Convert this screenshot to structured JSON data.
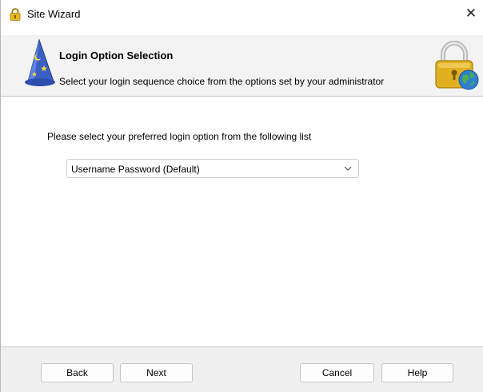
{
  "window": {
    "title": "Site Wizard",
    "close_glyph": "✕"
  },
  "header": {
    "title": "Login Option Selection",
    "subtitle": "Select your login sequence choice from the options set by your administrator",
    "left_icon": "wizard-hat-icon",
    "right_icon": "padlock-globe-icon"
  },
  "content": {
    "prompt": "Please select your preferred  login option from the following list",
    "login_option": {
      "selected": "Username Password  (Default)"
    }
  },
  "footer": {
    "back_label": "Back",
    "next_label": "Next",
    "cancel_label": "Cancel",
    "help_label": "Help"
  },
  "colors": {
    "header_bg": "#f3f3f3",
    "footer_bg": "#f0f0f0",
    "lock_gold": "#e0b020",
    "wizard_blue": "#3b5fc4"
  }
}
